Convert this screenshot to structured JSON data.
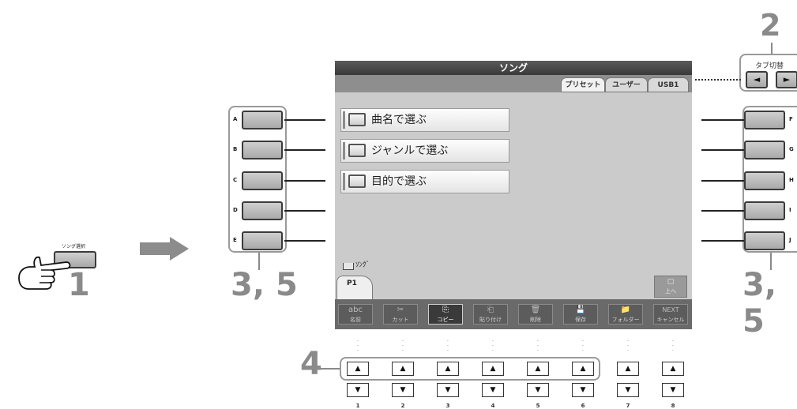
{
  "left_panel": {
    "button_label": "ソング選択",
    "step": "1"
  },
  "arrow": {
    "icon": "right-arrow-icon"
  },
  "screen": {
    "title": "ソング",
    "tabs": [
      {
        "label": "プリセット",
        "active": true
      },
      {
        "label": "ユーザー",
        "active": false
      },
      {
        "label": "USB1",
        "active": false
      }
    ],
    "menu_items": [
      {
        "label": "曲名で選ぶ"
      },
      {
        "label": "ジャンルで選ぶ"
      },
      {
        "label": "目的で選ぶ"
      }
    ],
    "path_label": "ｿﾝｸﾞ",
    "page_tab": "P1",
    "up_label": "上へ",
    "function_buttons": [
      {
        "label": "名前",
        "icon": "abc"
      },
      {
        "label": "カット",
        "icon": "✂"
      },
      {
        "label": "コピー",
        "icon": "⎘"
      },
      {
        "label": "貼り付け",
        "icon": "⎗"
      },
      {
        "label": "削除",
        "icon": "🗑"
      },
      {
        "label": "保存",
        "icon": "💾"
      },
      {
        "label": "フォルダー",
        "icon": "📁"
      },
      {
        "label": "キャンセル",
        "icon": "NEXT"
      }
    ]
  },
  "tab_switch": {
    "label": "タブ切替",
    "step": "2",
    "left": "◄",
    "right": "►"
  },
  "left_buttons": [
    "A",
    "B",
    "C",
    "D",
    "E"
  ],
  "right_buttons": [
    "F",
    "G",
    "H",
    "I",
    "J"
  ],
  "steps": {
    "left": "3, 5",
    "right": "3, 5",
    "bottom": "4"
  },
  "bottom_buttons": {
    "numbers": [
      "1",
      "2",
      "3",
      "4",
      "5",
      "6",
      "7",
      "8"
    ],
    "up": "▲",
    "down": "▼"
  }
}
